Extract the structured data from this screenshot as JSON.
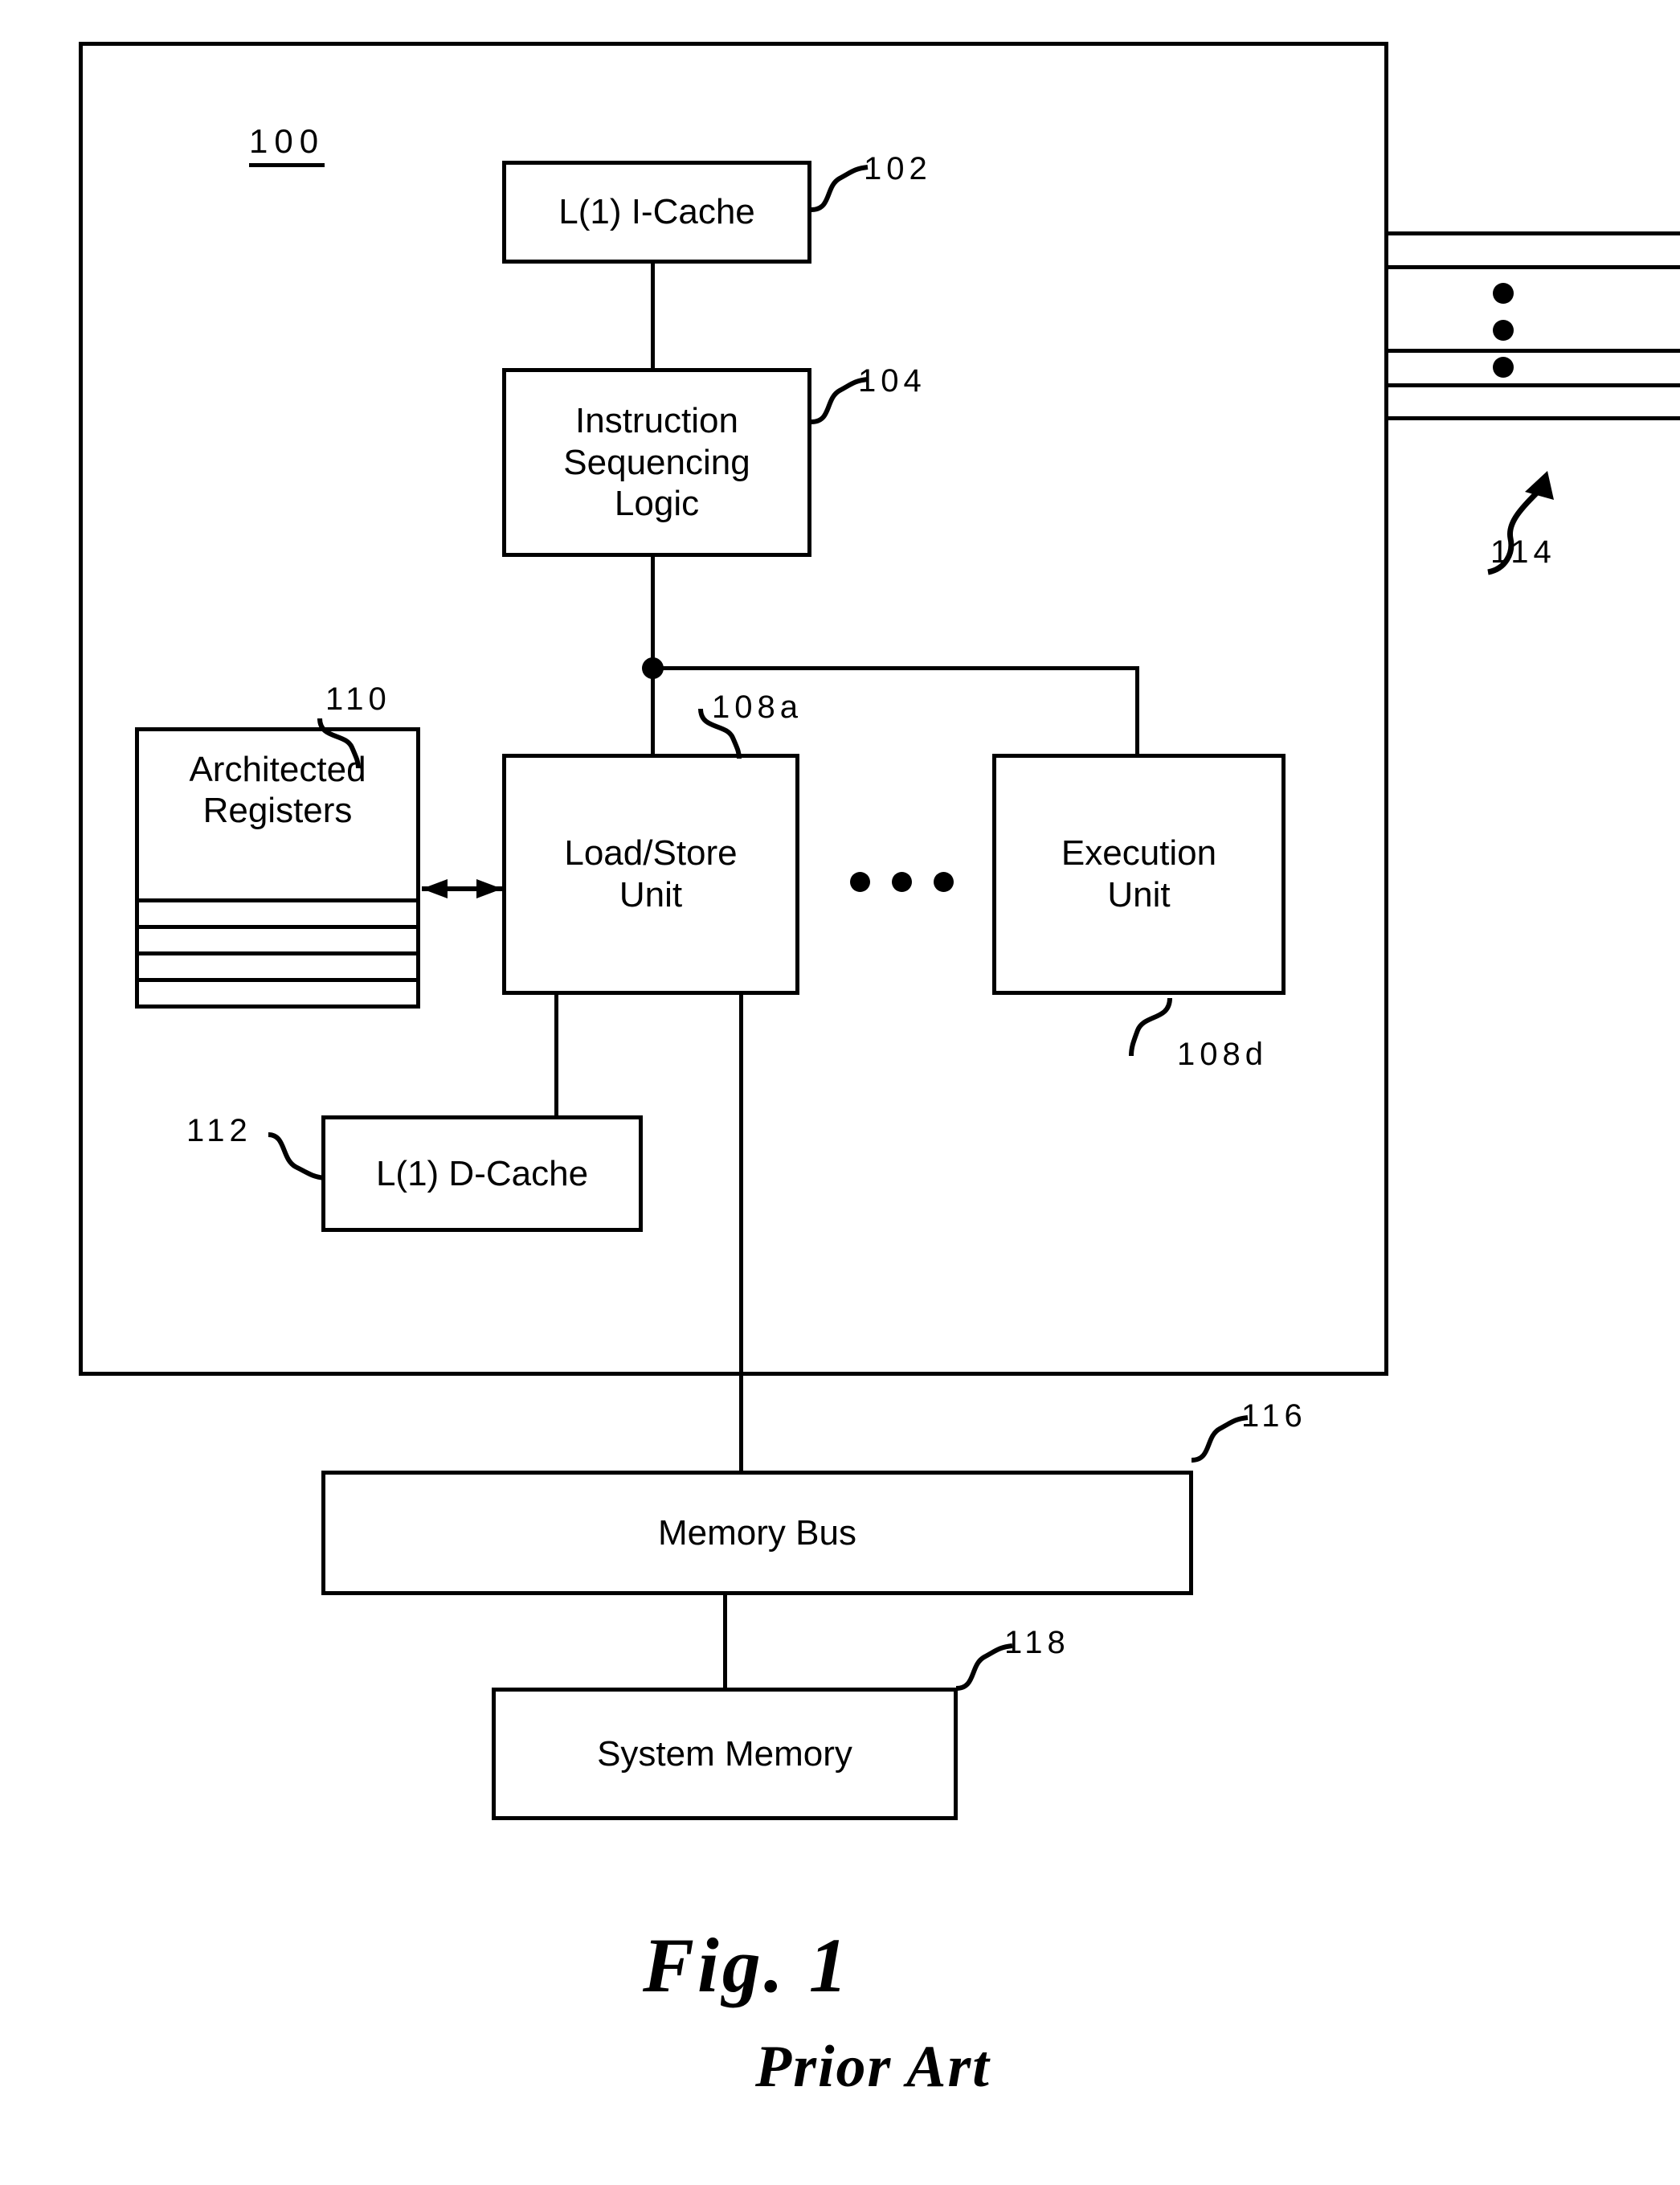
{
  "figure": {
    "number_label": "100",
    "caption_main": "Fig.  1",
    "caption_sub": "Prior Art"
  },
  "blocks": {
    "icache": {
      "label": "L(1) I-Cache",
      "ref": "102"
    },
    "isl": {
      "line1": "Instruction",
      "line2": "Sequencing",
      "line3": "Logic",
      "ref": "104"
    },
    "archregs": {
      "line1": "Architected",
      "line2": "Registers",
      "ref": "110"
    },
    "lsu": {
      "line1": "Load/Store",
      "line2": "Unit",
      "ref": "108a"
    },
    "eu": {
      "line1": "Execution",
      "line2": "Unit",
      "ref": "108d"
    },
    "dcache": {
      "label": "L(1) D-Cache",
      "ref": "112"
    },
    "membus": {
      "label": "Memory Bus",
      "ref": "116"
    },
    "sysmem": {
      "label": "System Memory",
      "ref": "118"
    }
  },
  "interconnect": {
    "external_bus_ref": "114",
    "external_bus_line_count": 5,
    "ellipsis_between_units": "• • •",
    "vertical_ellipsis": "⋮"
  },
  "colors": {
    "ink": "#000000",
    "paper": "#ffffff"
  }
}
